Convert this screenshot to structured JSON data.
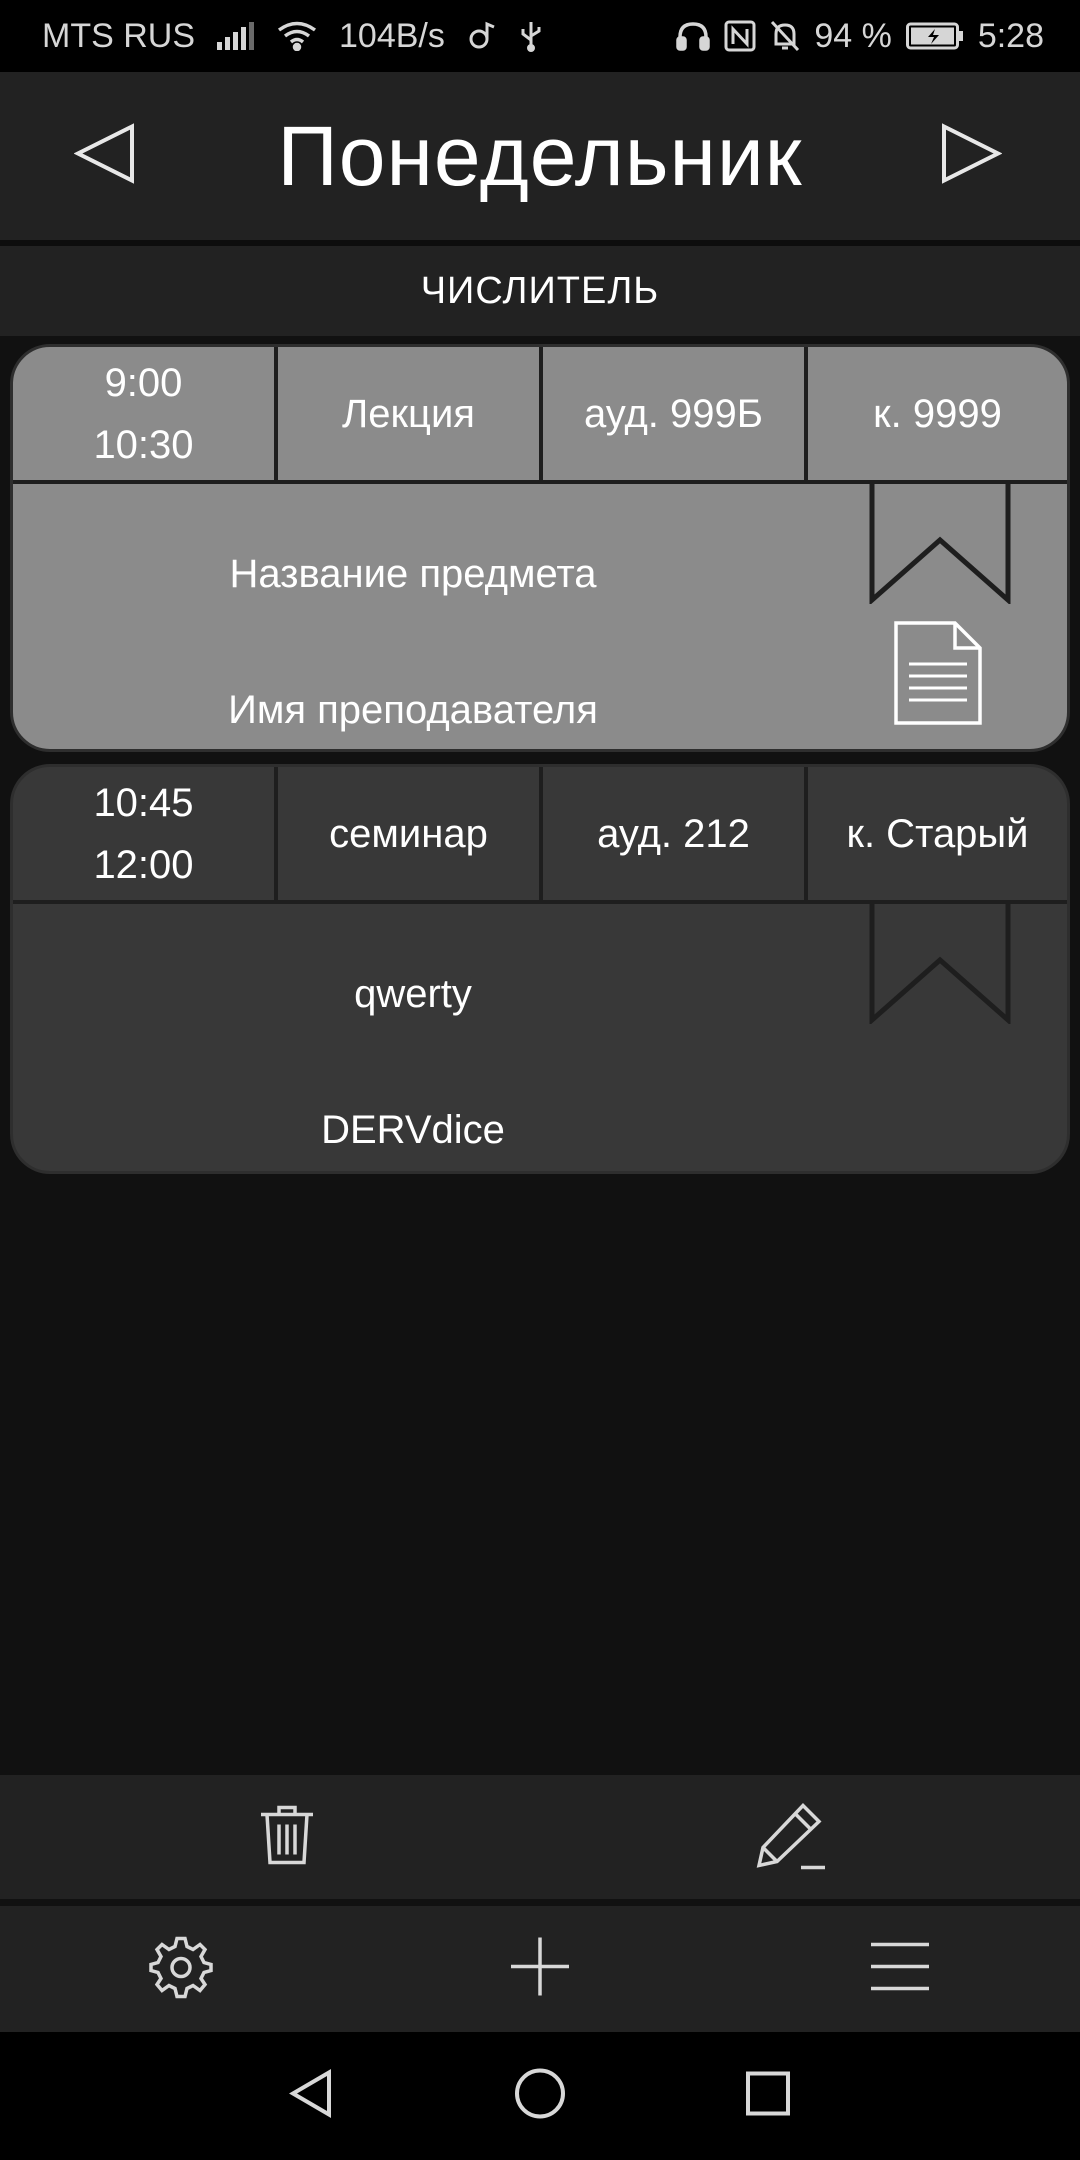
{
  "status_bar": {
    "carrier": "MTS RUS",
    "net_speed": "104B/s",
    "battery": "94 %",
    "time": "5:28",
    "icons": [
      "signal-icon",
      "wifi-icon",
      "music-icon",
      "usb-icon",
      "headphones-icon",
      "nfc-icon",
      "mute-bell-icon",
      "battery-icon"
    ]
  },
  "header": {
    "title": "Понедельник",
    "prev_icon": "triangle-left-icon",
    "next_icon": "triangle-right-icon"
  },
  "week_type": "ЧИСЛИТЕЛЬ",
  "lessons": [
    {
      "start": "9:00",
      "end": "10:30",
      "type": "Лекция",
      "room": "ауд. 999Б",
      "building": "к. 9999",
      "subject": "Название предмета",
      "teacher": "Имя преподавателя",
      "style": "light",
      "has_note": true
    },
    {
      "start": "10:45",
      "end": "12:00",
      "type": "семинар",
      "room": "ауд. 212",
      "building": "к. Старый",
      "subject": "qwerty",
      "teacher": "DERVdice",
      "style": "dark",
      "has_note": false
    }
  ],
  "action_bar": {
    "icons": [
      "trash-icon",
      "pencil-icon"
    ]
  },
  "bottom_bar": {
    "icons": [
      "gear-icon",
      "plus-icon",
      "menu-icon"
    ]
  },
  "system_nav": {
    "icons": [
      "back-icon",
      "home-icon",
      "recents-icon"
    ]
  },
  "colors": {
    "background": "#111111",
    "bar": "#222222",
    "card_light": "#8b8b8b",
    "card_dark": "#383838"
  }
}
